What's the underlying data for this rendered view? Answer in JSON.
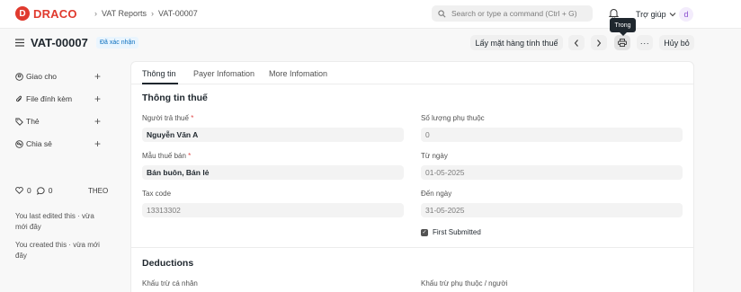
{
  "brand": {
    "name": "DRACO",
    "logo_letter": "D",
    "color": "#e03a2e"
  },
  "breadcrumb": [
    "VAT Reports",
    "VAT-00007"
  ],
  "search": {
    "placeholder": "Search or type a command (Ctrl + G)"
  },
  "help": {
    "label": "Trợ giúp"
  },
  "user": {
    "initial": "d"
  },
  "tooltip": {
    "text": "Trong"
  },
  "doc": {
    "title": "VAT-00007",
    "status": "Đã xác nhận"
  },
  "actions": {
    "fetch": "Lấy mặt hàng tính thuế",
    "cancel": "Hủy bỏ"
  },
  "sidebar": {
    "items": [
      {
        "label": "Giao cho",
        "icon": "assign-icon"
      },
      {
        "label": "File đính kèm",
        "icon": "paperclip-icon"
      },
      {
        "label": "Thẻ",
        "icon": "tag-icon"
      },
      {
        "label": "Chia sẻ",
        "icon": "share-icon"
      }
    ],
    "likes": "0",
    "comments": "0",
    "follow": "THEO",
    "activity": [
      "You last edited this · vừa mới đây",
      "You created this · vừa mới đây"
    ]
  },
  "tabs": [
    "Thông tin",
    "Payer Infomation",
    "More Infomation"
  ],
  "section_tax": {
    "title": "Thông tin thuế",
    "taxpayer_label": "Người trả thuế",
    "taxpayer_value": "Nguyễn Văn A",
    "dependents_label": "Số lượng phụ thuộc",
    "dependents_value": "0",
    "template_label": "Mẫu thuế bán",
    "template_value": "Bán buôn, Bán lẻ",
    "from_label": "Từ ngày",
    "from_value": "01-05-2025",
    "taxcode_label": "Tax code",
    "taxcode_value": "13313302",
    "to_label": "Đến ngày",
    "to_value": "31-05-2025",
    "first_submitted_label": "First Submitted",
    "first_submitted_checked": true
  },
  "section_deductions": {
    "title": "Deductions",
    "personal_label": "Khấu trừ cá nhân",
    "dependent_label": "Khấu trừ phụ thuộc / người"
  }
}
